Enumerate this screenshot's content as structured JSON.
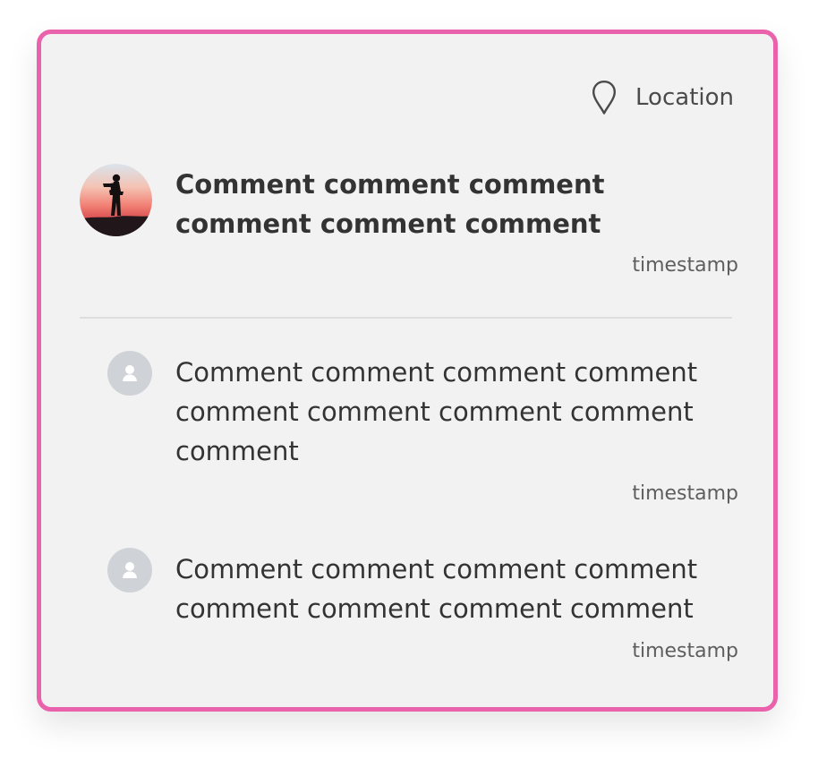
{
  "location": {
    "icon": "map-pin-icon",
    "label": "Location"
  },
  "main_comment": {
    "avatar": "profile-photo",
    "text": "Comment comment comment comment comment comment",
    "timestamp": "timestamp"
  },
  "replies": [
    {
      "avatar_icon": "user-icon",
      "text": "Comment comment comment comment comment comment comment comment comment",
      "timestamp": "timestamp"
    },
    {
      "avatar_icon": "user-icon",
      "text": "Comment comment comment comment comment comment comment comment",
      "timestamp": "timestamp"
    }
  ],
  "colors": {
    "card_border": "#e962ab",
    "card_background": "#f2f2f2",
    "text_primary": "#333333",
    "text_secondary": "#5e5e5e",
    "divider": "#dedede",
    "avatar_placeholder": "#cfd3d8"
  }
}
